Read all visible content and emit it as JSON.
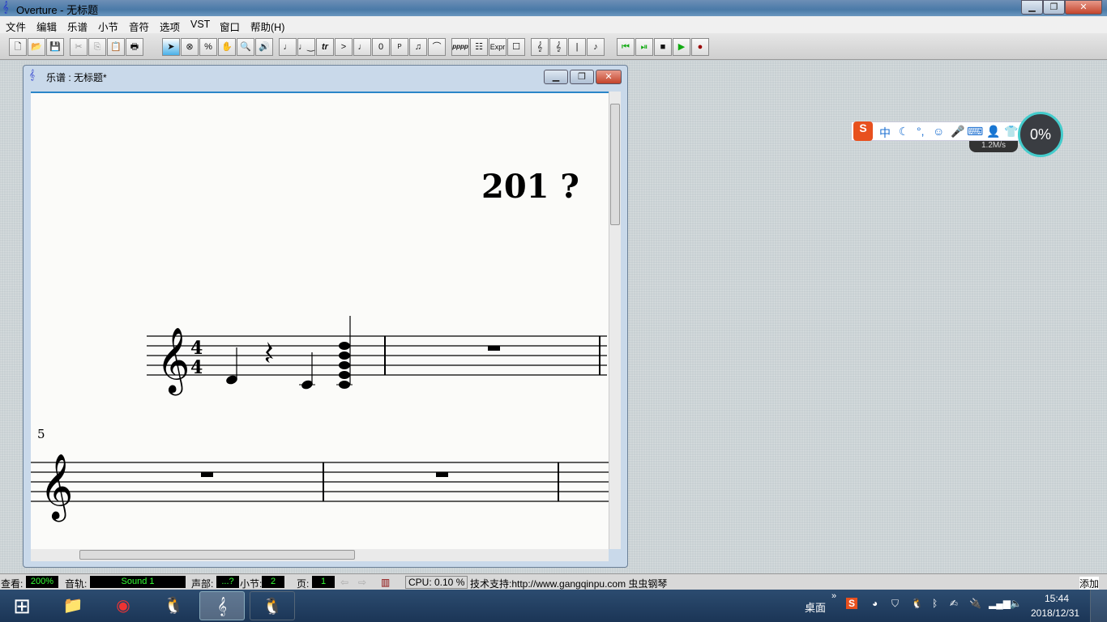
{
  "app": {
    "title": "Overture - 无标题"
  },
  "menu": [
    "文件",
    "编辑",
    "乐谱",
    "小节",
    "音符",
    "选项",
    "VST",
    "窗口",
    "帮助(H)"
  ],
  "toolbar": {
    "buttons": [
      "new",
      "open",
      "save",
      "cut",
      "copy",
      "paste",
      "print",
      "select",
      "erase",
      "percent",
      "hand",
      "zoom",
      "speaker",
      "quarter-note",
      "tie",
      "tr",
      "accent",
      ".",
      "0",
      "P",
      "beam",
      "slur",
      "pppp",
      "table",
      "Expr",
      "box",
      "treble-clef",
      "percussion-clef",
      "barline",
      "lyrics-note",
      "rewind",
      "step",
      "stop",
      "play",
      "record"
    ],
    "labels": {
      "tr": "tr",
      "accent": ">",
      "zero": "0",
      "p": "P",
      "pppp": "pppp",
      "expr": "Expr"
    }
  },
  "child": {
    "title": "乐谱 : 无标题*"
  },
  "score": {
    "title": "201 ?",
    "time_signature": [
      "4",
      "4"
    ],
    "measure_number": "5",
    "notes": [
      "D4 quarter",
      "quarter rest",
      "C4 quarter",
      "C4-E4-G4-B4-D5 chord"
    ],
    "rests": [
      "whole rest",
      "whole rest",
      "whole rest"
    ]
  },
  "status": {
    "view_label": "查看:",
    "view_value": "200%",
    "track_label": "音轨:",
    "track_value": "Sound 1",
    "voice_label": "声部:",
    "voice_value": "...?",
    "measure_label": "小节:",
    "measure_value": "2",
    "page_label": "页:",
    "page_value": "1",
    "cpu": "CPU: 0.10 %",
    "support": "技术支持:http://www.gangqinpu.com 虫虫钢琴",
    "add": "添加"
  },
  "ime": {
    "lang": "中",
    "speed": "1.2M/s",
    "percent": "0%"
  },
  "taskbar": {
    "desktop": "桌面",
    "chevron": "»",
    "time": "15:44",
    "date": "2018/12/31"
  }
}
